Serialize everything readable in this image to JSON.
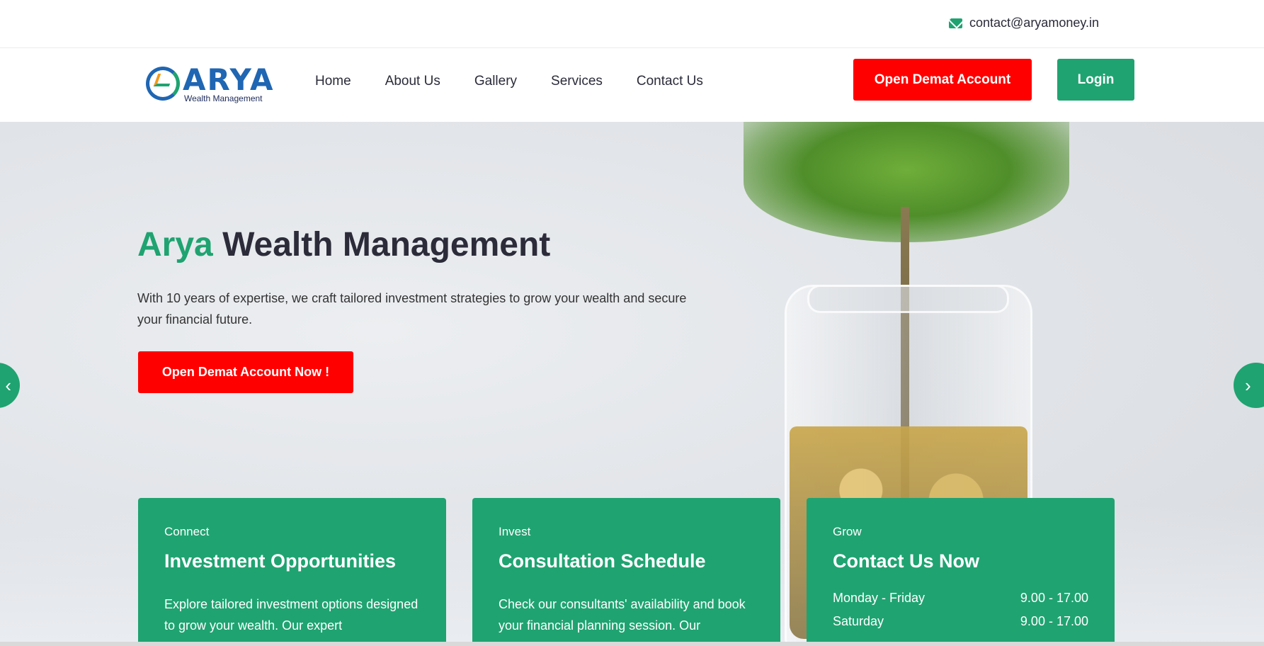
{
  "topbar": {
    "email": "contact@aryamoney.in",
    "icon": "mail-icon"
  },
  "brand": {
    "logo_text": "ARYA",
    "logo_subtitle": "Wealth Management"
  },
  "nav": {
    "items": [
      "Home",
      "About Us",
      "Gallery",
      "Services",
      "Contact Us"
    ],
    "demat_button": "Open Demat Account",
    "login_button": "Login"
  },
  "hero": {
    "title_accent": "Arya",
    "title_rest": "Wealth Management",
    "description": "With 10 years of expertise, we craft tailored investment strategies to grow your wealth and secure your financial future.",
    "cta": "Open Demat Account Now !",
    "prev_icon": "chevron-left-icon",
    "next_icon": "chevron-right-icon"
  },
  "cards": [
    {
      "kicker": "Connect",
      "title": "Investment Opportunities",
      "text": "Explore tailored investment options designed to grow your wealth. Our expert"
    },
    {
      "kicker": "Invest",
      "title": "Consultation Schedule",
      "text": "Check our consultants' availability and book your financial planning session. Our"
    },
    {
      "kicker": "Grow",
      "title": "Contact Us Now",
      "hours": [
        {
          "day": "Monday - Friday",
          "time": "9.00 - 17.00"
        },
        {
          "day": "Saturday",
          "time": "9.00 - 17.00"
        }
      ]
    }
  ],
  "colors": {
    "brand_green": "#1fa371",
    "cta_red": "#ff0000",
    "text_dark": "#2b2b3a"
  }
}
